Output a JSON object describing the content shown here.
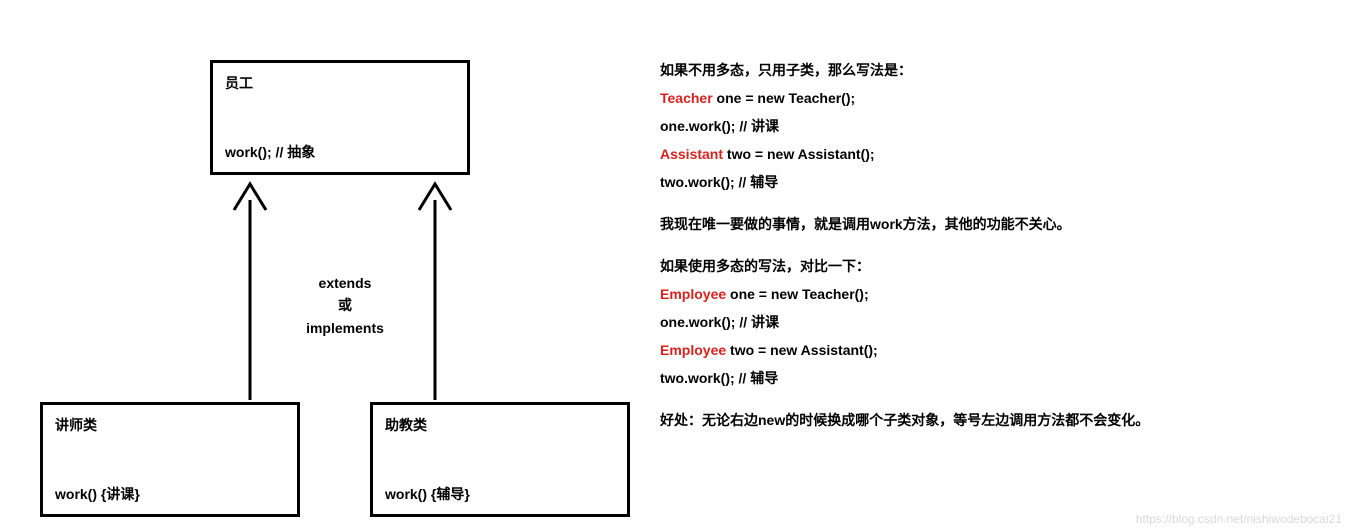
{
  "diagram": {
    "parent": {
      "title": "员工",
      "method": "work(); // 抽象"
    },
    "relation": {
      "line1": "extends",
      "line2": "或",
      "line3": "implements"
    },
    "childLeft": {
      "title": "讲师类",
      "method": "work() {讲课}"
    },
    "childRight": {
      "title": "助教类",
      "method": "work() {辅导}"
    }
  },
  "explain": {
    "p1": "如果不用多态，只用子类，那么写法是：",
    "p2a": "Teacher",
    "p2b": " one = new Teacher();",
    "p3": "one.work(); // 讲课",
    "p4a": "Assistant",
    "p4b": " two = new Assistant();",
    "p5": "two.work(); // 辅导",
    "p6": "我现在唯一要做的事情，就是调用work方法，其他的功能不关心。",
    "p7": "如果使用多态的写法，对比一下：",
    "p8a": "Employee",
    "p8b": " one = new Teacher();",
    "p9": "one.work(); // 讲课",
    "p10a": "Employee",
    "p10b": " two = new Assistant();",
    "p11": "two.work(); // 辅导",
    "p12": "好处：无论右边new的时候换成哪个子类对象，等号左边调用方法都不会变化。"
  },
  "watermark": "https://blog.csdn.net/nishiwodebocai21"
}
